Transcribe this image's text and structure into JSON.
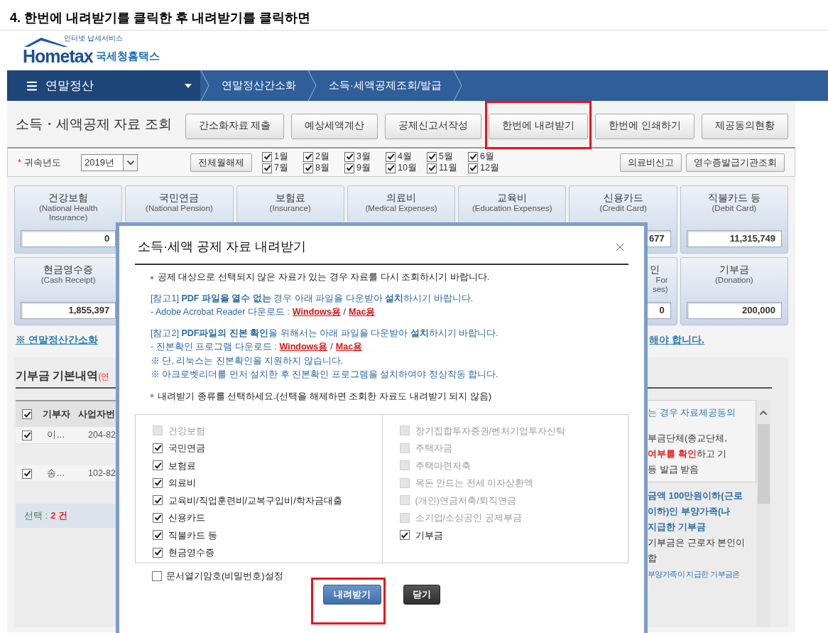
{
  "heading": "4. 한번에 내려받기를 클릭한 후 내려받기를 클릭하면",
  "logo": {
    "tagline": "인터넷 납세서비스",
    "wordmark": "Hometax",
    "name": "국세청홈택스"
  },
  "nav": {
    "menu": "연말정산",
    "breadcrumbs": [
      "연말정산간소화",
      "소득·세액공제조회/발급"
    ]
  },
  "page_title": "소득・세액공제 자료 조회",
  "actions": [
    {
      "label": "간소화자료 제출",
      "highlighted": false
    },
    {
      "label": "예상세액계산",
      "highlighted": false
    },
    {
      "label": "공제신고서작성",
      "highlighted": false
    },
    {
      "label": "한번에 내려받기",
      "highlighted": true
    },
    {
      "label": "한번에 인쇄하기",
      "highlighted": false
    },
    {
      "label": "제공동의현황",
      "highlighted": false
    }
  ],
  "filter": {
    "required_mark": "*",
    "label": "귀속년도",
    "year": "2019년",
    "clear_button": "전체월해제",
    "months": [
      {
        "label": "1월",
        "checked": true
      },
      {
        "label": "2월",
        "checked": true
      },
      {
        "label": "3월",
        "checked": true
      },
      {
        "label": "4월",
        "checked": true
      },
      {
        "label": "5월",
        "checked": true
      },
      {
        "label": "6월",
        "checked": true
      },
      {
        "label": "7월",
        "checked": true
      },
      {
        "label": "8월",
        "checked": true
      },
      {
        "label": "9월",
        "checked": true
      },
      {
        "label": "10월",
        "checked": true
      },
      {
        "label": "11월",
        "checked": true
      },
      {
        "label": "12월",
        "checked": true
      }
    ],
    "buttons": [
      "의료비신고",
      "영수증발급기관조회"
    ]
  },
  "cards_row1": [
    {
      "title": "건강보험",
      "subtitle": "(National Health Insurance)",
      "value": "0"
    },
    {
      "title": "국민연금",
      "subtitle": "(National Pension)"
    },
    {
      "title": "보험료",
      "subtitle": "(Insurance)"
    },
    {
      "title": "의료비",
      "subtitle": "(Medical Expenses)"
    },
    {
      "title": "교육비",
      "subtitle": "(Education Expenses)"
    },
    {
      "title": "신용카드",
      "subtitle": "(Credit Card)",
      "value": "677"
    },
    {
      "title": "직불카드 등",
      "subtitle": "(Debit Card)",
      "value": "11,315,749"
    }
  ],
  "cards_row2": [
    {
      "kind": "full",
      "title": "현금영수증",
      "subtitle": "(Cash Receipt)",
      "value": "1,855,397"
    },
    {
      "kind": "partial",
      "title": "인",
      "subtitle_lines": [
        "For",
        "ses)"
      ],
      "value": "0"
    },
    {
      "kind": "full",
      "title": "기부금",
      "subtitle": "(Donation)",
      "value": "200,000"
    }
  ],
  "notice_link": {
    "start": "※ 연말정산간소화",
    "end": "해야 합니다."
  },
  "donations": {
    "title": "기부금 기본내역",
    "title_suffix": "(연",
    "header_checked": true,
    "columns": [
      "기부자",
      "사업자번"
    ],
    "rows": [
      {
        "checked": true,
        "donor": "이…",
        "number": "204-82"
      },
      {
        "checked": true,
        "donor": "송…",
        "number": "102-82"
      }
    ],
    "summary_label": "선택 :",
    "summary_count": "2 건"
  },
  "side_panel": {
    "intro": "는 경우 자료제공동의",
    "box_lines": [
      "부금단체(종교단체,",
      "**여부를 확인**하고 기",
      "등 발급 받음"
    ],
    "emphasis_lines": [
      "금액 100만원이하(근로",
      "이하)인 부양가족(나",
      "지급한 기부금"
    ],
    "body_lines": [
      "기부금은 근로자 본인이",
      "합"
    ],
    "footer": "부양가족이 지급한 기부금은"
  },
  "dialog": {
    "title": "소득·세액 공제 자료 내려받기",
    "notice": "공제 대상으로 선택되지 않은 자료가 있는 경우 자료를 다시 조회하시기 바랍니다.",
    "references": [
      {
        "text": "[참고1] **PDF 파일을 열수 없는** 경우  아래 파일을 다운받아 **설치**하시기 바랍니다.",
        "download_label": "- Adobe Acrobat Reader 다운로드 :",
        "links": [
          "Windows용",
          "Mac용"
        ],
        "separator": "/"
      },
      {
        "text": "[참고2] **PDF파일의 진본 확인**을 위해서는 아래 파일을 다운받아 **설치**하시기 바랍니다.",
        "download_label": "- 진본확인 프로그램 다운로드 :",
        "links": [
          "Windows용",
          "Mac용"
        ],
        "separator": "/",
        "notes": [
          "※ 단, 리눅스는 진본확인을 지원하지 않습니다.",
          "※ 아크로벳리더를 먼저 설치한 후 진본확인 프로그램을 설치하여야 정상작동 합니다."
        ]
      }
    ],
    "select_prompt": "내려받기 종류를 선택하세요.(선택을 해제하면 조회한 자료도 내려받기 되지 않음)",
    "left_items": [
      {
        "label": "건강보험",
        "checked": false,
        "disabled": true
      },
      {
        "label": "국민연금",
        "checked": true,
        "disabled": false
      },
      {
        "label": "보험료",
        "checked": true,
        "disabled": false
      },
      {
        "label": "의료비",
        "checked": true,
        "disabled": false
      },
      {
        "label": "교육비/직업훈련비/교복구입비/학자금대출",
        "checked": true,
        "disabled": false
      },
      {
        "label": "신용카드",
        "checked": true,
        "disabled": false
      },
      {
        "label": "직불카드 등",
        "checked": true,
        "disabled": false
      },
      {
        "label": "현금영수증",
        "checked": true,
        "disabled": false
      }
    ],
    "right_items": [
      {
        "label": "장기집합투자증권/벤처기업투자신탁",
        "checked": false,
        "disabled": true
      },
      {
        "label": "주택자금",
        "checked": false,
        "disabled": true
      },
      {
        "label": "주택마련저축",
        "checked": false,
        "disabled": true
      },
      {
        "label": "목돈 안드는 전세 이자상환액",
        "checked": false,
        "disabled": true
      },
      {
        "label": "(개인)연금저축/퇴직연금",
        "checked": false,
        "disabled": true
      },
      {
        "label": "소기업/소상공인 공제부금",
        "checked": false,
        "disabled": true
      },
      {
        "label": "기부금",
        "checked": true,
        "disabled": false
      }
    ],
    "password_option": {
      "label": "문서열기암호(비밀번호)설정",
      "checked": false
    },
    "buttons": [
      {
        "label": "내려받기",
        "kind": "primary",
        "highlighted": true
      },
      {
        "label": "닫기",
        "kind": "secondary",
        "highlighted": false
      }
    ]
  }
}
